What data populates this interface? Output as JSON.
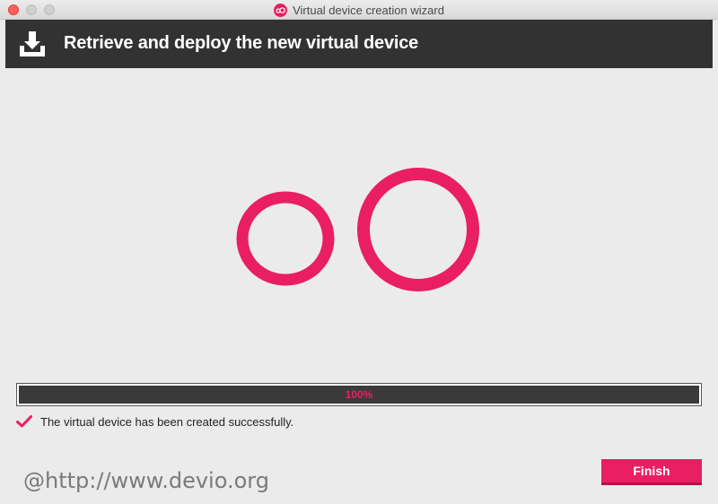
{
  "window": {
    "title": "Virtual device creation wizard",
    "app_icon": "genymotion-logo-icon"
  },
  "header": {
    "icon": "download-icon",
    "title": "Retrieve and deploy the new virtual device"
  },
  "logo": {
    "icon": "genymotion-oO-logo-icon",
    "color": "#e91e63"
  },
  "progress": {
    "value": 100,
    "label": "100%"
  },
  "status": {
    "icon": "checkmark-icon",
    "text": "The virtual device has been created successfully."
  },
  "watermark": {
    "text": "@http://www.devio.org"
  },
  "footer": {
    "finish_label": "Finish"
  },
  "colors": {
    "accent": "#e91e63",
    "header_bg": "#323232",
    "window_bg": "#ebebeb",
    "progress_bg": "#3a3a3a"
  }
}
